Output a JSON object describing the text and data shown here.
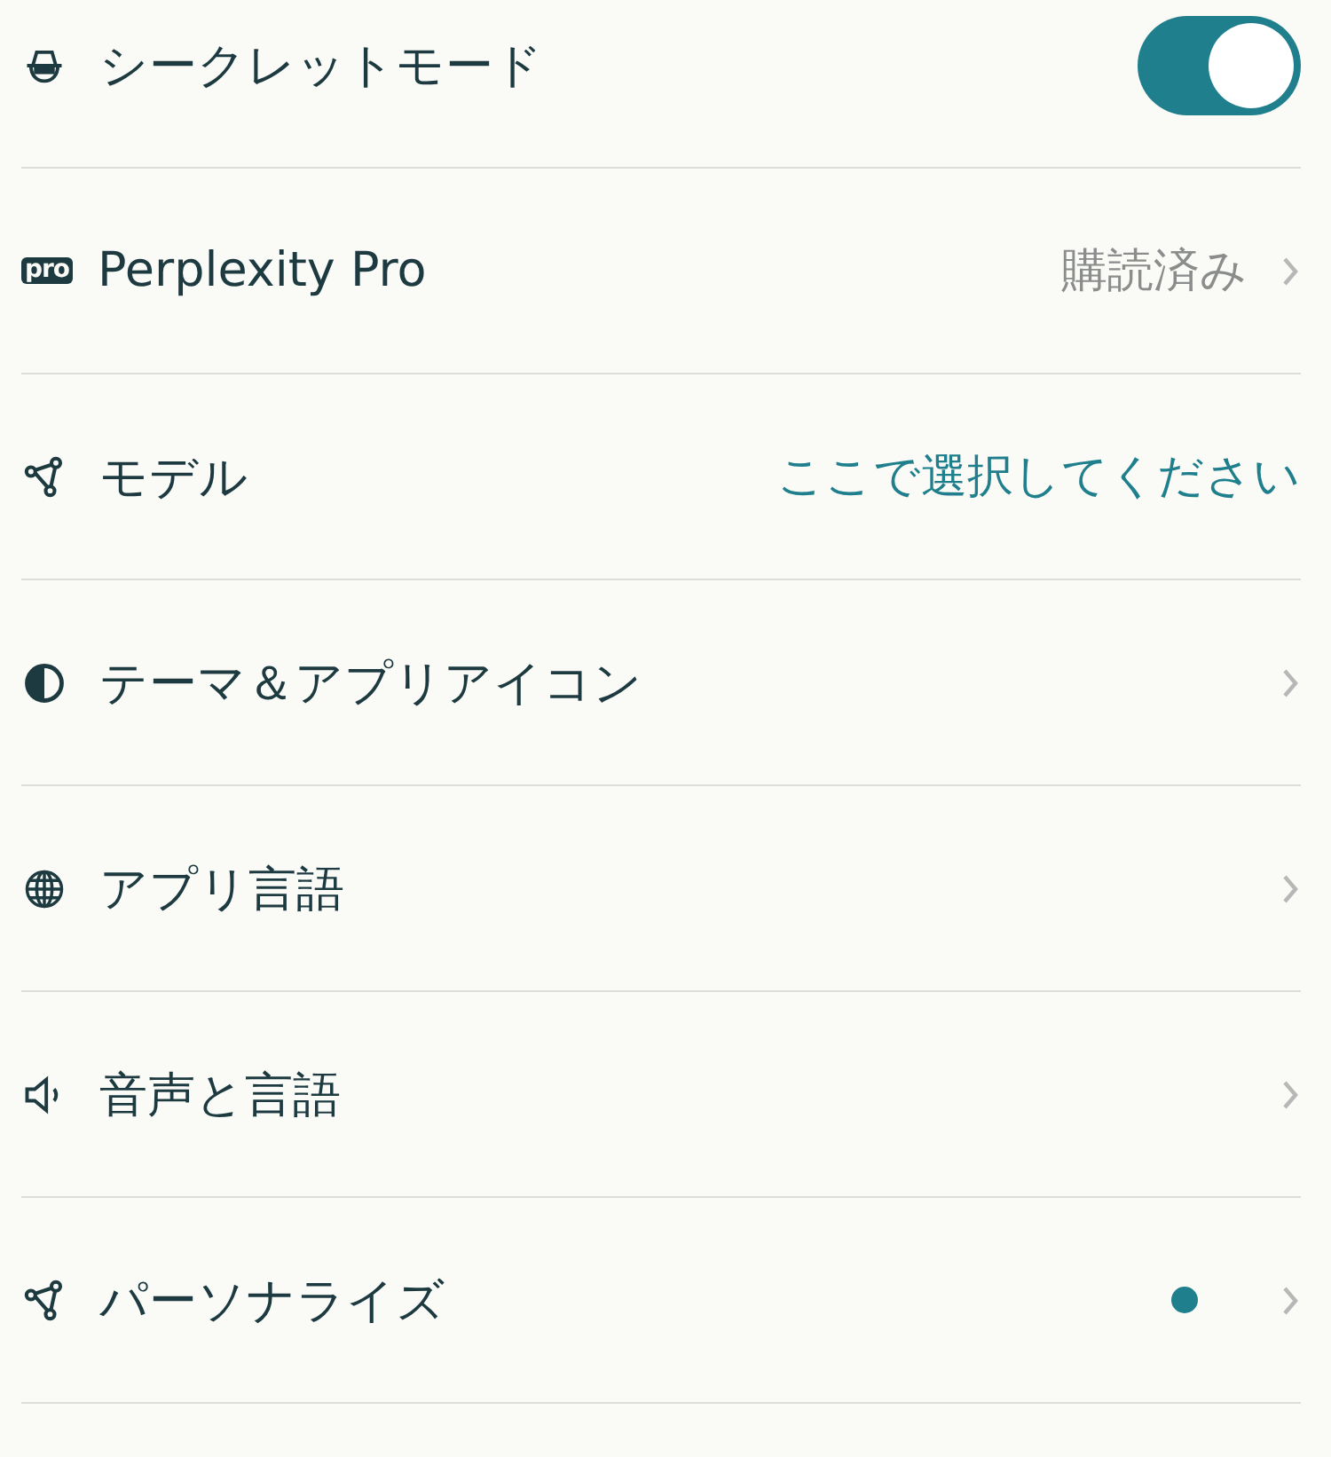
{
  "settings": [
    {
      "kind": "toggle",
      "label": "シークレットモード",
      "on": true
    },
    {
      "kind": "link",
      "label": "Perplexity Pro",
      "icon_text": "pro",
      "value": "購読済み"
    },
    {
      "kind": "select",
      "label": "モデル",
      "value": "ここで選択してください"
    },
    {
      "kind": "nav",
      "label": "テーマ＆アプリアイコン"
    },
    {
      "kind": "nav",
      "label": "アプリ言語"
    },
    {
      "kind": "nav",
      "label": "音声と言語"
    },
    {
      "kind": "dot",
      "label": "パーソナライズ",
      "color": "#1f7f8c"
    }
  ]
}
